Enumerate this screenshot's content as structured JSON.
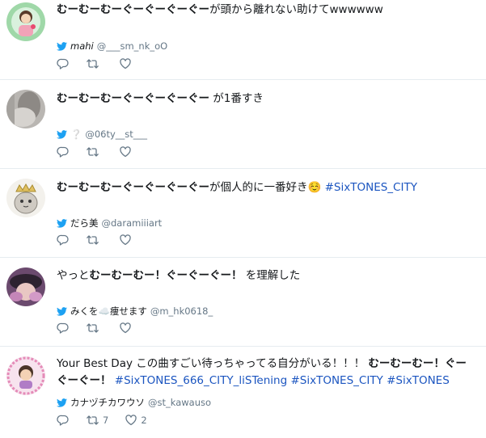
{
  "tweets": [
    {
      "text_bold": "むーむーむーぐーぐーぐーぐー",
      "text_rest": "が頭から離れない助けてwwwwww",
      "tags": "",
      "author_name": "mahi",
      "author_handle": "@___sm_nk_oO",
      "retweets": "",
      "likes": ""
    },
    {
      "text_bold": "むーむーむーぐーぐーぐーぐー",
      "text_rest": " が1番すき",
      "tags": "",
      "author_name": "❔",
      "author_handle": "@06ty__st___",
      "retweets": "",
      "likes": ""
    },
    {
      "text_bold": "むーむーむーぐーぐーぐーぐー",
      "text_rest": "が個人的に一番好き☺️ ",
      "tags": "#SixTONES_CITY",
      "author_name": "だら美",
      "author_handle": "@daramiiiart",
      "retweets": "",
      "likes": ""
    },
    {
      "text_pre": "やっと",
      "text_bold": "むーむーむー！ぐーぐーぐー！",
      "text_rest": " を理解した",
      "tags": "",
      "author_name": "みくを☁️痩せます",
      "author_handle": "@m_hk0618_",
      "retweets": "",
      "likes": ""
    },
    {
      "text_pre": "Your Best Day この曲すごい待っちゃってる自分がいる！！！ ",
      "text_bold": "むーむーむー！ぐーぐーぐー！",
      "text_rest": " ",
      "tags": "#SixTONES_666_CITY_liSTening #SixTONES_CITY #SixTONES",
      "author_name": "カナヅチカワウソ",
      "author_handle": "@st_kawauso",
      "retweets": "7",
      "likes": "2"
    }
  ],
  "colors": {
    "twitter_blue": "#1da1f2",
    "hashtag": "#1b55c0",
    "muted": "#657786",
    "divider": "#e6ecf0"
  },
  "icons": {
    "brand": "twitter-bird-icon",
    "reply": "reply-icon",
    "retweet": "retweet-icon",
    "like": "heart-icon"
  }
}
